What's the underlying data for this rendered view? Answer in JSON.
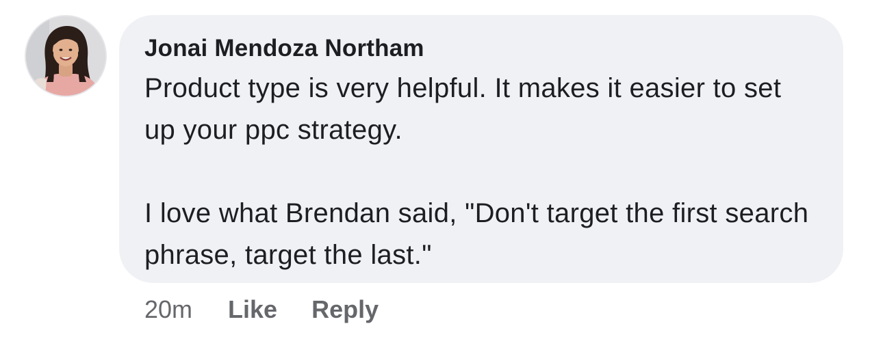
{
  "comment": {
    "author": "Jonai Mendoza Northam",
    "paragraphs": [
      "Product type is very helpful. It makes it easier to set up your ppc strategy.",
      "I love what Brendan said, \"Don't target the first search phrase, target the last.\""
    ],
    "timestamp": "20m",
    "like_label": "Like",
    "reply_label": "Reply"
  },
  "colors": {
    "bubble_background": "#f0f1f5",
    "text_primary": "#1c1e21",
    "text_secondary": "#65676b"
  }
}
